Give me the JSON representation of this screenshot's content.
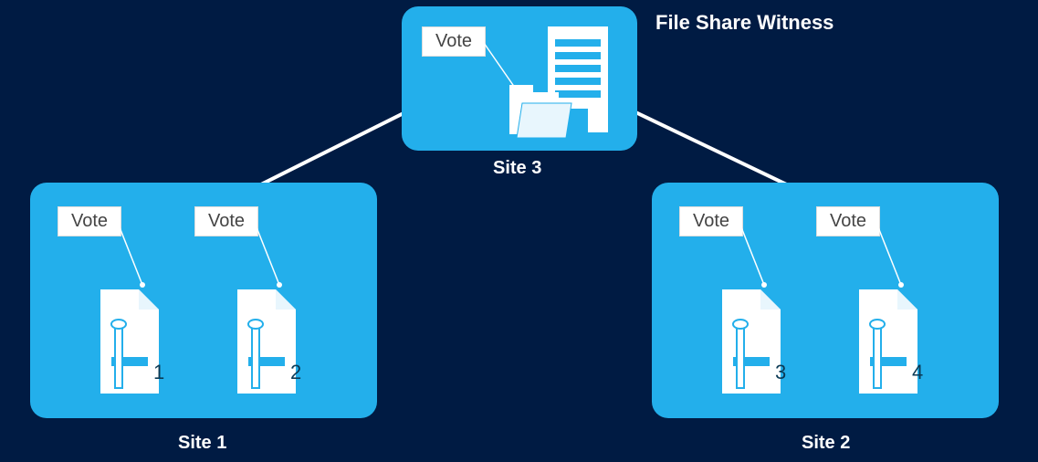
{
  "witness_title": "File Share Witness",
  "sites": {
    "top": {
      "label": "Site 3"
    },
    "left": {
      "label": "Site 1"
    },
    "right": {
      "label": "Site 2"
    }
  },
  "vote_label": "Vote",
  "servers": {
    "s1": "1",
    "s2": "2",
    "s3": "3",
    "s4": "4"
  }
}
